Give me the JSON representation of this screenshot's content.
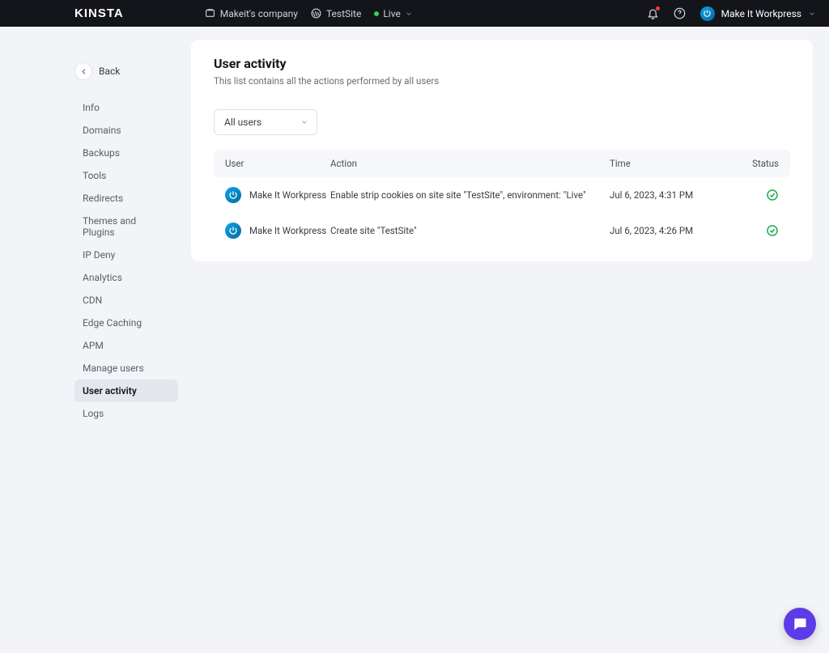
{
  "header": {
    "logo": "KINSTA",
    "breadcrumb_company": "Makeit's company",
    "breadcrumb_site": "TestSite",
    "breadcrumb_env": "Live",
    "username": "Make It Workpress"
  },
  "colors": {
    "status_ok": "#1aab4a",
    "accent": "#5b3ce6",
    "env_live": "#34d058"
  },
  "sidebar": {
    "back_label": "Back",
    "items": [
      "Info",
      "Domains",
      "Backups",
      "Tools",
      "Redirects",
      "Themes and Plugins",
      "IP Deny",
      "Analytics",
      "CDN",
      "Edge Caching",
      "APM",
      "Manage users",
      "User activity",
      "Logs"
    ],
    "active_index": 12
  },
  "page": {
    "title": "User activity",
    "subtitle": "This list contains all the actions performed by all users"
  },
  "filter": {
    "selected": "All users"
  },
  "table": {
    "columns": [
      "User",
      "Action",
      "Time",
      "Status"
    ],
    "rows": [
      {
        "user": "Make It Workpress",
        "action": "Enable strip cookies on site site \"TestSite\", environment: \"Live\"",
        "time": "Jul 6, 2023, 4:31 PM",
        "status": "ok"
      },
      {
        "user": "Make It Workpress",
        "action": "Create site \"TestSite\"",
        "time": "Jul 6, 2023, 4:26 PM",
        "status": "ok"
      }
    ]
  }
}
